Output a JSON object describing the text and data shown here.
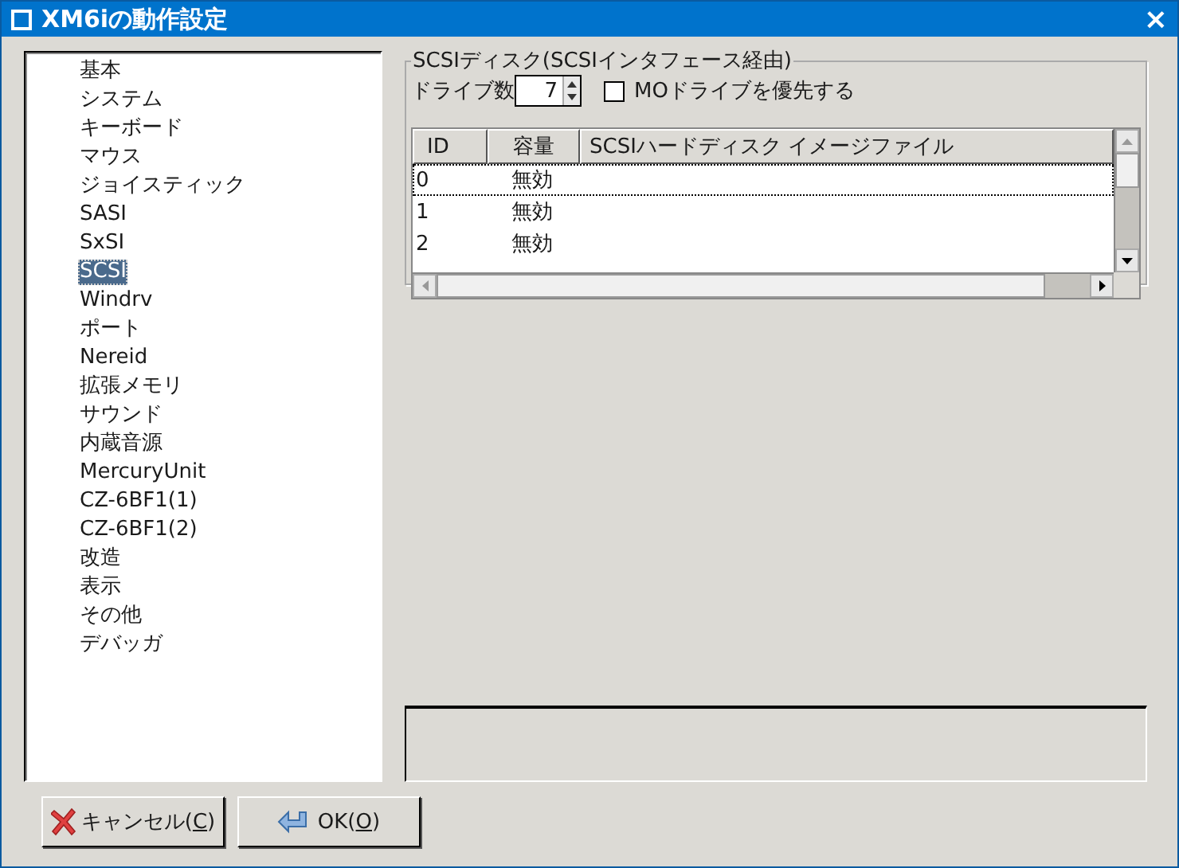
{
  "window": {
    "title": "XM6iの動作設定",
    "close": "×"
  },
  "sidebar": {
    "items": [
      {
        "label": "基本",
        "selected": false
      },
      {
        "label": "システム",
        "selected": false
      },
      {
        "label": "キーボード",
        "selected": false
      },
      {
        "label": "マウス",
        "selected": false
      },
      {
        "label": "ジョイスティック",
        "selected": false
      },
      {
        "label": "SASI",
        "selected": false
      },
      {
        "label": "SxSI",
        "selected": false
      },
      {
        "label": "SCSI",
        "selected": true
      },
      {
        "label": "Windrv",
        "selected": false
      },
      {
        "label": "ポート",
        "selected": false
      },
      {
        "label": "Nereid",
        "selected": false
      },
      {
        "label": "拡張メモリ",
        "selected": false
      },
      {
        "label": "サウンド",
        "selected": false
      },
      {
        "label": "内蔵音源",
        "selected": false
      },
      {
        "label": "MercuryUnit",
        "selected": false
      },
      {
        "label": "CZ-6BF1(1)",
        "selected": false
      },
      {
        "label": "CZ-6BF1(2)",
        "selected": false
      },
      {
        "label": "改造",
        "selected": false
      },
      {
        "label": "表示",
        "selected": false
      },
      {
        "label": "その他",
        "selected": false
      },
      {
        "label": "デバッガ",
        "selected": false
      }
    ]
  },
  "scsi_group": {
    "title": "SCSIディスク(SCSIインタフェース経由)",
    "drive_count_label": "ドライブ数",
    "drive_count": "7",
    "mo_priority": {
      "label": "MOドライブを優先する",
      "checked": false
    },
    "table": {
      "columns": [
        "ID",
        "容量",
        "SCSIハードディスク イメージファイル"
      ],
      "rows": [
        {
          "id": "0",
          "capacity": "無効",
          "selected": true
        },
        {
          "id": "1",
          "capacity": "無効",
          "selected": false
        },
        {
          "id": "2",
          "capacity": "無効",
          "selected": false
        }
      ]
    }
  },
  "buttons": [
    {
      "kind": "cancel",
      "label_before": "キャンセル(",
      "mnemonic": "C",
      "label_after": ")"
    },
    {
      "kind": "ok",
      "label_before": "OK(",
      "mnemonic": "O",
      "label_after": ")"
    }
  ]
}
